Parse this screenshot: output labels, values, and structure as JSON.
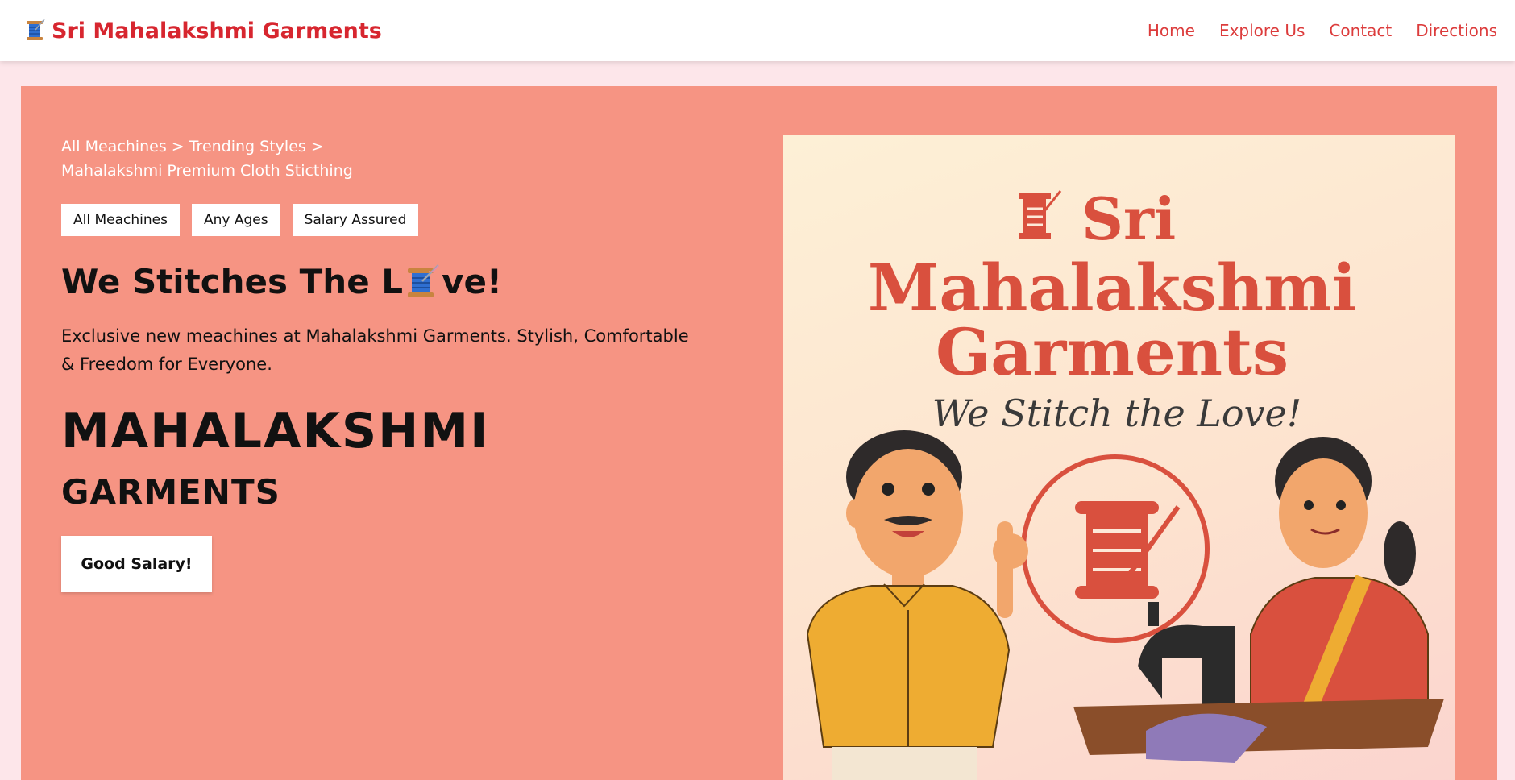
{
  "nav": {
    "brand": "Sri Mahalakshmi Garments",
    "links": [
      "Home",
      "Explore Us",
      "Contact",
      "Directions"
    ]
  },
  "hero": {
    "breadcrumb": [
      "All Meachines",
      "Trending Styles",
      "Mahalakshmi Premium Cloth Sticthing"
    ],
    "breadcrumb_separator": ">",
    "tags": [
      "All Meachines",
      "Any Ages",
      "Salary Assured"
    ],
    "headline_start": "We Stitches The L",
    "headline_end": "ve!",
    "description": "Exclusive new meachines at Mahalakshmi Garments. Stylish, Comfortable & Freedom for Everyone.",
    "big_title_1": "MAHALAKSHMI",
    "big_title_2": "GARMENTS",
    "cta_label": "Good Salary!"
  },
  "poster": {
    "line1": "Sri",
    "line2": "Mahalakshmi",
    "line3": "Garments",
    "tagline": "We Stitch the Love!"
  },
  "colors": {
    "brand_red": "#d7262f",
    "nav_link": "#dc3c3c",
    "hero_bg": "#f69483",
    "page_bg": "#fde6ea",
    "poster_red": "#d9503e"
  },
  "icons": [
    "thread-spool-icon",
    "spool-needle-icon",
    "spool-logo-icon"
  ]
}
